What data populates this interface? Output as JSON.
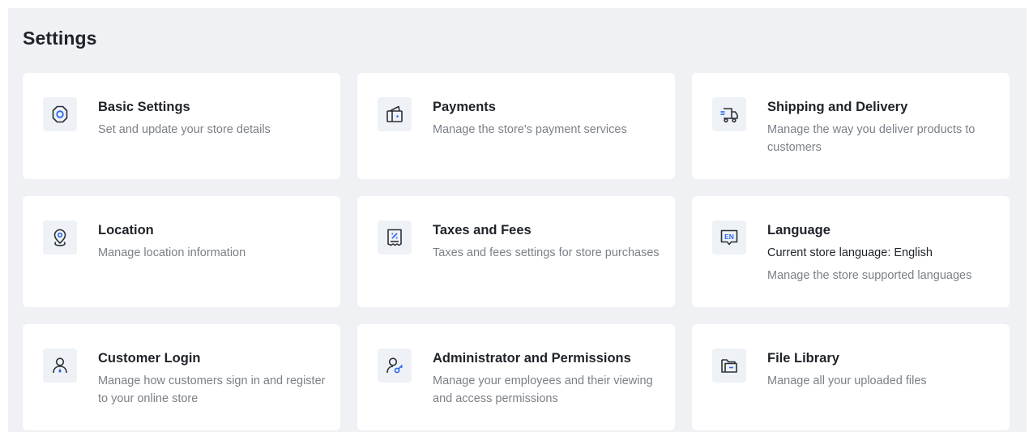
{
  "page": {
    "title": "Settings"
  },
  "colors": {
    "accent": "#2a6ae9",
    "icon_stroke": "#2b2f36",
    "icon_bg": "#eef1f6"
  },
  "cards": {
    "basic": {
      "title": "Basic Settings",
      "desc": "Set and update your store details",
      "icon": "gear-icon"
    },
    "payments": {
      "title": "Payments",
      "desc": "Manage the store's payment services",
      "icon": "wallet-icon"
    },
    "shipping": {
      "title": "Shipping and Delivery",
      "desc": "Manage the way you deliver products to customers",
      "icon": "truck-icon"
    },
    "location": {
      "title": "Location",
      "desc": "Manage location information",
      "icon": "map-pin-icon"
    },
    "taxes": {
      "title": "Taxes and Fees",
      "desc": "Taxes and fees settings for store purchases",
      "icon": "receipt-icon"
    },
    "language": {
      "title": "Language",
      "current": "Current store language: English",
      "desc": "Manage the store supported languages",
      "icon": "language-icon",
      "icon_text": "EN"
    },
    "login": {
      "title": "Customer Login",
      "desc": "Manage how customers sign in and register to your online store",
      "icon": "user-icon"
    },
    "admin": {
      "title": "Administrator and Permissions",
      "desc": "Manage your employees and their viewing and access permissions",
      "icon": "user-key-icon"
    },
    "files": {
      "title": "File Library",
      "desc": "Manage all your uploaded files",
      "icon": "folder-icon"
    }
  }
}
